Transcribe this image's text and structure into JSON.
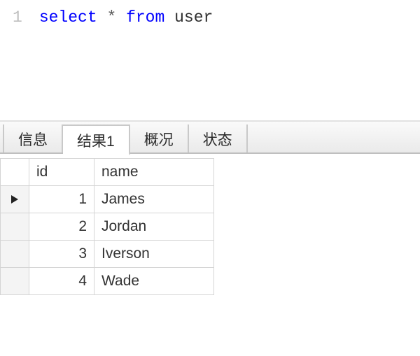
{
  "editor": {
    "line_number": "1",
    "kw_select": "select",
    "star": "*",
    "kw_from": "from",
    "table_name": "user"
  },
  "tabs": {
    "info": "信息",
    "result1": "结果1",
    "profile": "概况",
    "status": "状态",
    "active_index": 1
  },
  "columns": {
    "id": "id",
    "name": "name"
  },
  "rows": [
    {
      "id": "1",
      "name": "James"
    },
    {
      "id": "2",
      "name": "Jordan"
    },
    {
      "id": "3",
      "name": "Iverson"
    },
    {
      "id": "4",
      "name": "Wade"
    }
  ],
  "chart_data": {
    "type": "table",
    "title": "select * from user",
    "columns": [
      "id",
      "name"
    ],
    "rows": [
      [
        1,
        "James"
      ],
      [
        2,
        "Jordan"
      ],
      [
        3,
        "Iverson"
      ],
      [
        4,
        "Wade"
      ]
    ]
  }
}
